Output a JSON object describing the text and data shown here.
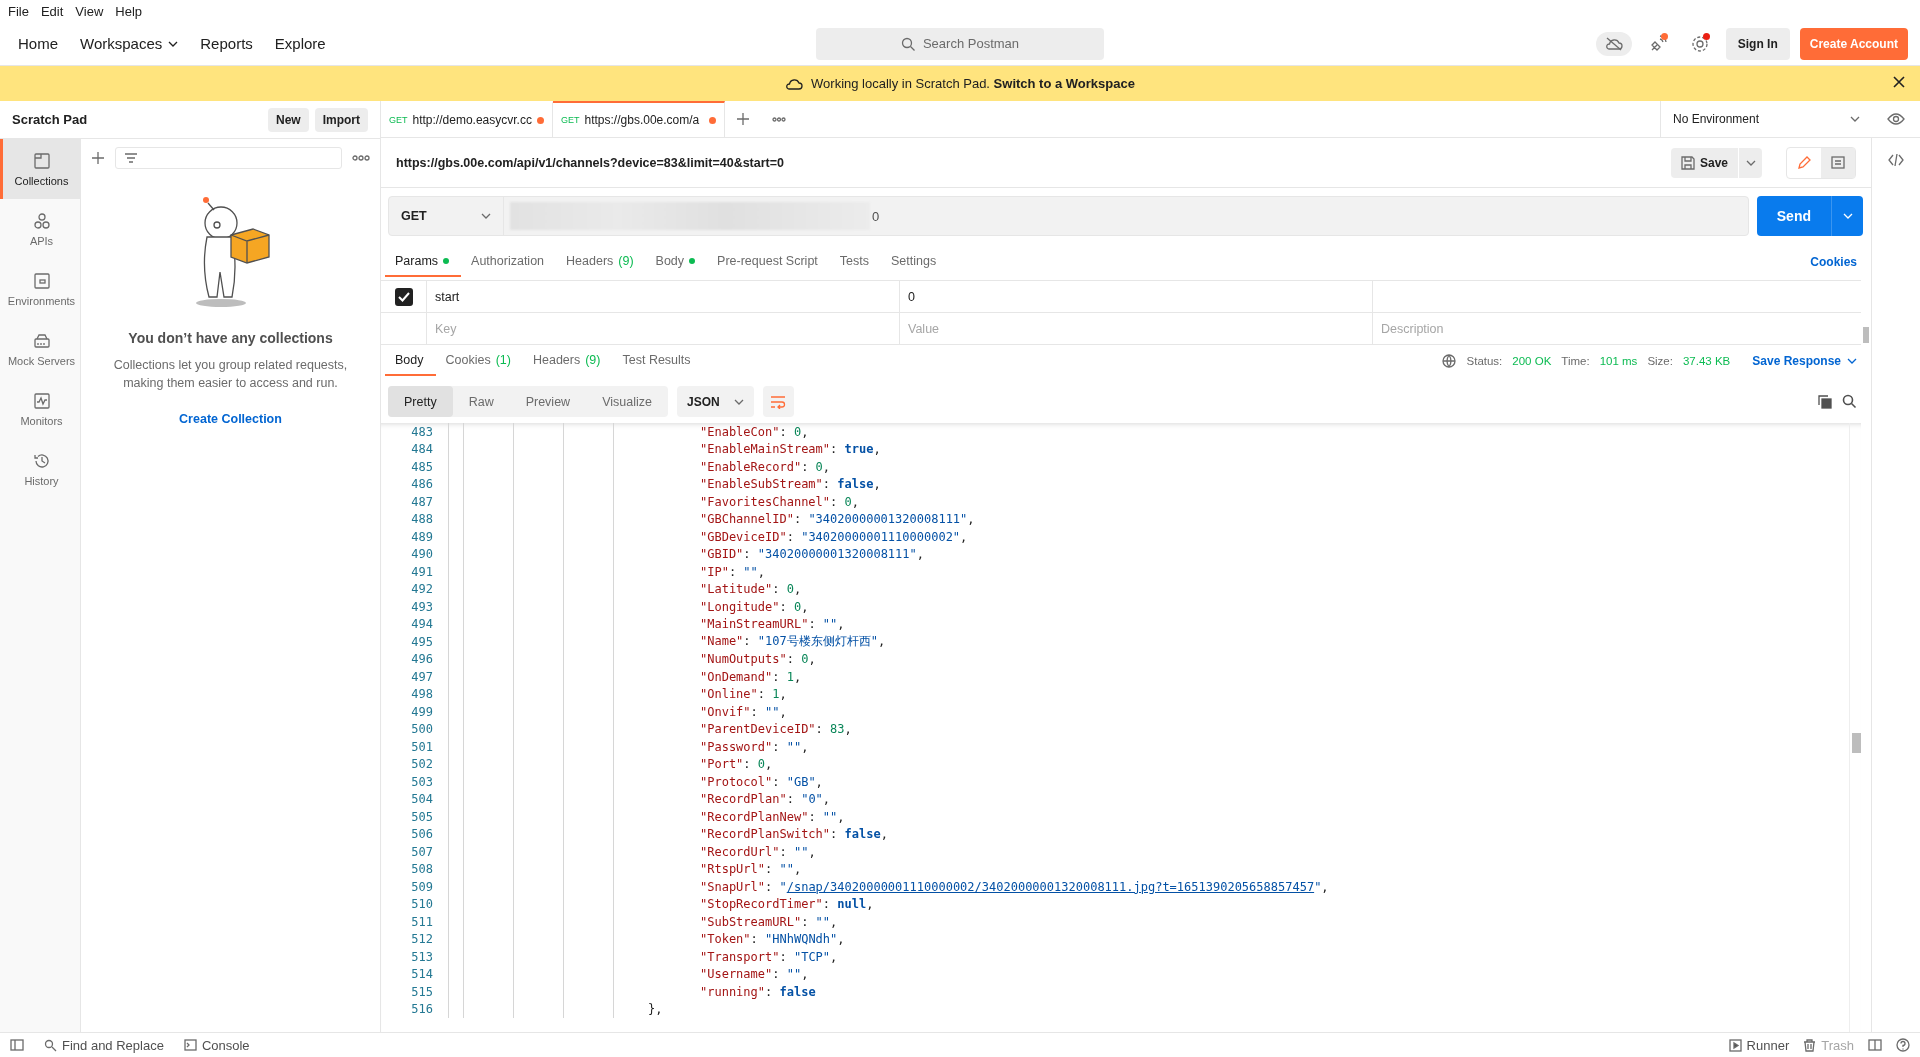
{
  "menu_bar": [
    "File",
    "Edit",
    "View",
    "Help"
  ],
  "header": {
    "nav": [
      {
        "label": "Home",
        "dropdown": false
      },
      {
        "label": "Workspaces",
        "dropdown": true
      },
      {
        "label": "Reports",
        "dropdown": false
      },
      {
        "label": "Explore",
        "dropdown": false
      }
    ],
    "search": {
      "placeholder": "Search Postman"
    },
    "sign_in": "Sign In",
    "create_account": "Create Account"
  },
  "banner": {
    "message": "Working locally in Scratch Pad. **Switch to a Workspace**"
  },
  "sidebar": {
    "title": "Scratch Pad",
    "buttons": [
      "New",
      "Import"
    ],
    "rail": [
      {
        "label": "Collections",
        "selected": true
      },
      {
        "label": "APIs",
        "selected": false
      },
      {
        "label": "Environments",
        "selected": false
      },
      {
        "label": "Mock Servers",
        "selected": false
      },
      {
        "label": "Monitors",
        "selected": false
      },
      {
        "label": "History",
        "selected": false
      }
    ],
    "empty_state": {
      "title": "You don’t have any collections",
      "description": "Collections let you group related requests, making them easier to access and run.",
      "action": "Create Collection"
    }
  },
  "request_tabs": [
    {
      "method": "GET",
      "label": "http://demo.easycvr.cc",
      "unsaved": true,
      "selected": false
    },
    {
      "method": "GET",
      "label": "https://gbs.00e.com/a",
      "unsaved": true,
      "selected": true
    }
  ],
  "environment": "No Environment",
  "request": {
    "title": "https://gbs.00e.com/api/v1/channels?device=83&limit=40&start=0",
    "save": "Save",
    "method": "GET",
    "url_visible": "0",
    "send": "Send",
    "tabs": [
      {
        "label": "Params",
        "dot": true,
        "selected": true
      },
      {
        "label": "Authorization",
        "dot": false,
        "selected": false
      },
      {
        "label": "Headers",
        "count": "(9)",
        "dot": false,
        "selected": false
      },
      {
        "label": "Body",
        "dot": true,
        "selected": false
      },
      {
        "label": "Pre-request Script",
        "dot": false,
        "selected": false
      },
      {
        "label": "Tests",
        "dot": false,
        "selected": false
      },
      {
        "label": "Settings",
        "dot": false,
        "selected": false
      }
    ],
    "cookies_link": "Cookies",
    "params": [
      {
        "checked": true,
        "key": "start",
        "value": "0"
      }
    ],
    "new_param": [
      {
        "placeholder": "Key"
      },
      {
        "placeholder": "Value"
      },
      {
        "placeholder": "Description"
      }
    ]
  },
  "response": {
    "tabs": [
      {
        "label": "Body",
        "selected": true
      },
      {
        "label": "Cookies",
        "count": "(1)",
        "selected": false
      },
      {
        "label": "Headers",
        "count": "(9)",
        "selected": false
      },
      {
        "label": "Test Results",
        "selected": false
      }
    ],
    "status": [
      {
        "label": "Status:",
        "value": "200 OK"
      },
      {
        "label": "Time:",
        "value": "101 ms"
      },
      {
        "label": "Size:",
        "value": "37.43 KB"
      }
    ],
    "save_response": "Save Response",
    "views": [
      {
        "label": "Pretty",
        "selected": true
      },
      {
        "label": "Raw",
        "selected": false
      },
      {
        "label": "Preview",
        "selected": false
      },
      {
        "label": "Visualize",
        "selected": false
      }
    ],
    "format": "JSON",
    "lines": [
      {
        "number": "483",
        "kind": "property",
        "tokens": [
          {
            "kind": "key",
            "text": "\"EnableCon\""
          },
          {
            "kind": "punct",
            "text": ": "
          },
          {
            "kind": "number",
            "text": "0"
          },
          {
            "kind": "punct",
            "text": ","
          }
        ]
      },
      {
        "number": "484",
        "kind": "property",
        "tokens": [
          {
            "kind": "key",
            "text": "\"EnableMainStream\""
          },
          {
            "kind": "punct",
            "text": ": "
          },
          {
            "kind": "keyword",
            "text": "true"
          },
          {
            "kind": "punct",
            "text": ","
          }
        ]
      },
      {
        "number": "485",
        "kind": "property",
        "tokens": [
          {
            "kind": "key",
            "text": "\"EnableRecord\""
          },
          {
            "kind": "punct",
            "text": ": "
          },
          {
            "kind": "number",
            "text": "0"
          },
          {
            "kind": "punct",
            "text": ","
          }
        ]
      },
      {
        "number": "486",
        "kind": "property",
        "tokens": [
          {
            "kind": "key",
            "text": "\"EnableSubStream\""
          },
          {
            "kind": "punct",
            "text": ": "
          },
          {
            "kind": "keyword",
            "text": "false"
          },
          {
            "kind": "punct",
            "text": ","
          }
        ]
      },
      {
        "number": "487",
        "kind": "property",
        "tokens": [
          {
            "kind": "key",
            "text": "\"FavoritesChannel\""
          },
          {
            "kind": "punct",
            "text": ": "
          },
          {
            "kind": "number",
            "text": "0"
          },
          {
            "kind": "punct",
            "text": ","
          }
        ]
      },
      {
        "number": "488",
        "kind": "property",
        "tokens": [
          {
            "kind": "key",
            "text": "\"GBChannelID\""
          },
          {
            "kind": "punct",
            "text": ": "
          },
          {
            "kind": "string",
            "text": "\"34020000001320008111\""
          },
          {
            "kind": "punct",
            "text": ","
          }
        ]
      },
      {
        "number": "489",
        "kind": "property",
        "tokens": [
          {
            "kind": "key",
            "text": "\"GBDeviceID\""
          },
          {
            "kind": "punct",
            "text": ": "
          },
          {
            "kind": "string",
            "text": "\"34020000001110000002\""
          },
          {
            "kind": "punct",
            "text": ","
          }
        ]
      },
      {
        "number": "490",
        "kind": "property",
        "tokens": [
          {
            "kind": "key",
            "text": "\"GBID\""
          },
          {
            "kind": "punct",
            "text": ": "
          },
          {
            "kind": "string",
            "text": "\"34020000001320008111\""
          },
          {
            "kind": "punct",
            "text": ","
          }
        ]
      },
      {
        "number": "491",
        "kind": "property",
        "tokens": [
          {
            "kind": "key",
            "text": "\"IP\""
          },
          {
            "kind": "punct",
            "text": ": "
          },
          {
            "kind": "string",
            "text": "\"\""
          },
          {
            "kind": "punct",
            "text": ","
          }
        ]
      },
      {
        "number": "492",
        "kind": "property",
        "tokens": [
          {
            "kind": "key",
            "text": "\"Latitude\""
          },
          {
            "kind": "punct",
            "text": ": "
          },
          {
            "kind": "number",
            "text": "0"
          },
          {
            "kind": "punct",
            "text": ","
          }
        ]
      },
      {
        "number": "493",
        "kind": "property",
        "tokens": [
          {
            "kind": "key",
            "text": "\"Longitude\""
          },
          {
            "kind": "punct",
            "text": ": "
          },
          {
            "kind": "number",
            "text": "0"
          },
          {
            "kind": "punct",
            "text": ","
          }
        ]
      },
      {
        "number": "494",
        "kind": "property",
        "tokens": [
          {
            "kind": "key",
            "text": "\"MainStreamURL\""
          },
          {
            "kind": "punct",
            "text": ": "
          },
          {
            "kind": "string",
            "text": "\"\""
          },
          {
            "kind": "punct",
            "text": ","
          }
        ]
      },
      {
        "number": "495",
        "kind": "property",
        "tokens": [
          {
            "kind": "key",
            "text": "\"Name\""
          },
          {
            "kind": "punct",
            "text": ": "
          },
          {
            "kind": "string",
            "text": "\"107号楼东侧灯杆西\""
          },
          {
            "kind": "punct",
            "text": ","
          }
        ]
      },
      {
        "number": "496",
        "kind": "property",
        "tokens": [
          {
            "kind": "key",
            "text": "\"NumOutputs\""
          },
          {
            "kind": "punct",
            "text": ": "
          },
          {
            "kind": "number",
            "text": "0"
          },
          {
            "kind": "punct",
            "text": ","
          }
        ]
      },
      {
        "number": "497",
        "kind": "property",
        "tokens": [
          {
            "kind": "key",
            "text": "\"OnDemand\""
          },
          {
            "kind": "punct",
            "text": ": "
          },
          {
            "kind": "number",
            "text": "1"
          },
          {
            "kind": "punct",
            "text": ","
          }
        ]
      },
      {
        "number": "498",
        "kind": "property",
        "tokens": [
          {
            "kind": "key",
            "text": "\"Online\""
          },
          {
            "kind": "punct",
            "text": ": "
          },
          {
            "kind": "number",
            "text": "1"
          },
          {
            "kind": "punct",
            "text": ","
          }
        ]
      },
      {
        "number": "499",
        "kind": "property",
        "tokens": [
          {
            "kind": "key",
            "text": "\"Onvif\""
          },
          {
            "kind": "punct",
            "text": ": "
          },
          {
            "kind": "string",
            "text": "\"\""
          },
          {
            "kind": "punct",
            "text": ","
          }
        ]
      },
      {
        "number": "500",
        "kind": "property",
        "tokens": [
          {
            "kind": "key",
            "text": "\"ParentDeviceID\""
          },
          {
            "kind": "punct",
            "text": ": "
          },
          {
            "kind": "number",
            "text": "83"
          },
          {
            "kind": "punct",
            "text": ","
          }
        ]
      },
      {
        "number": "501",
        "kind": "property",
        "tokens": [
          {
            "kind": "key",
            "text": "\"Password\""
          },
          {
            "kind": "punct",
            "text": ": "
          },
          {
            "kind": "string",
            "text": "\"\""
          },
          {
            "kind": "punct",
            "text": ","
          }
        ]
      },
      {
        "number": "502",
        "kind": "property",
        "tokens": [
          {
            "kind": "key",
            "text": "\"Port\""
          },
          {
            "kind": "punct",
            "text": ": "
          },
          {
            "kind": "number",
            "text": "0"
          },
          {
            "kind": "punct",
            "text": ","
          }
        ]
      },
      {
        "number": "503",
        "kind": "property",
        "tokens": [
          {
            "kind": "key",
            "text": "\"Protocol\""
          },
          {
            "kind": "punct",
            "text": ": "
          },
          {
            "kind": "string",
            "text": "\"GB\""
          },
          {
            "kind": "punct",
            "text": ","
          }
        ]
      },
      {
        "number": "504",
        "kind": "property",
        "tokens": [
          {
            "kind": "key",
            "text": "\"RecordPlan\""
          },
          {
            "kind": "punct",
            "text": ": "
          },
          {
            "kind": "string",
            "text": "\"0\""
          },
          {
            "kind": "punct",
            "text": ","
          }
        ]
      },
      {
        "number": "505",
        "kind": "property",
        "tokens": [
          {
            "kind": "key",
            "text": "\"RecordPlanNew\""
          },
          {
            "kind": "punct",
            "text": ": "
          },
          {
            "kind": "string",
            "text": "\"\""
          },
          {
            "kind": "punct",
            "text": ","
          }
        ]
      },
      {
        "number": "506",
        "kind": "property",
        "tokens": [
          {
            "kind": "key",
            "text": "\"RecordPlanSwitch\""
          },
          {
            "kind": "punct",
            "text": ": "
          },
          {
            "kind": "keyword",
            "text": "false"
          },
          {
            "kind": "punct",
            "text": ","
          }
        ]
      },
      {
        "number": "507",
        "kind": "property",
        "tokens": [
          {
            "kind": "key",
            "text": "\"RecordUrl\""
          },
          {
            "kind": "punct",
            "text": ": "
          },
          {
            "kind": "string",
            "text": "\"\""
          },
          {
            "kind": "punct",
            "text": ","
          }
        ]
      },
      {
        "number": "508",
        "kind": "property",
        "tokens": [
          {
            "kind": "key",
            "text": "\"RtspUrl\""
          },
          {
            "kind": "punct",
            "text": ": "
          },
          {
            "kind": "string",
            "text": "\"\""
          },
          {
            "kind": "punct",
            "text": ","
          }
        ]
      },
      {
        "number": "509",
        "kind": "property",
        "tokens": [
          {
            "kind": "key",
            "text": "\"SnapUrl\""
          },
          {
            "kind": "punct",
            "text": ": "
          },
          {
            "kind": "string",
            "text": "\""
          },
          {
            "kind": "link",
            "text": "/snap/34020000001110000002/34020000001320008111.jpg?t=1651390205658857457"
          },
          {
            "kind": "string",
            "text": "\""
          },
          {
            "kind": "punct",
            "text": ","
          }
        ]
      },
      {
        "number": "510",
        "kind": "property",
        "tokens": [
          {
            "kind": "key",
            "text": "\"StopRecordTimer\""
          },
          {
            "kind": "punct",
            "text": ": "
          },
          {
            "kind": "keyword",
            "text": "null"
          },
          {
            "kind": "punct",
            "text": ","
          }
        ]
      },
      {
        "number": "511",
        "kind": "property",
        "tokens": [
          {
            "kind": "key",
            "text": "\"SubStreamURL\""
          },
          {
            "kind": "punct",
            "text": ": "
          },
          {
            "kind": "string",
            "text": "\"\""
          },
          {
            "kind": "punct",
            "text": ","
          }
        ]
      },
      {
        "number": "512",
        "kind": "property",
        "tokens": [
          {
            "kind": "key",
            "text": "\"Token\""
          },
          {
            "kind": "punct",
            "text": ": "
          },
          {
            "kind": "string",
            "text": "\"HNhWQNdh\""
          },
          {
            "kind": "punct",
            "text": ","
          }
        ]
      },
      {
        "number": "513",
        "kind": "property",
        "tokens": [
          {
            "kind": "key",
            "text": "\"Transport\""
          },
          {
            "kind": "punct",
            "text": ": "
          },
          {
            "kind": "string",
            "text": "\"TCP\""
          },
          {
            "kind": "punct",
            "text": ","
          }
        ]
      },
      {
        "number": "514",
        "kind": "property",
        "tokens": [
          {
            "kind": "key",
            "text": "\"Username\""
          },
          {
            "kind": "punct",
            "text": ": "
          },
          {
            "kind": "string",
            "text": "\"\""
          },
          {
            "kind": "punct",
            "text": ","
          }
        ]
      },
      {
        "number": "515",
        "kind": "property",
        "tokens": [
          {
            "kind": "key",
            "text": "\"running\""
          },
          {
            "kind": "punct",
            "text": ": "
          },
          {
            "kind": "keyword",
            "text": "false"
          }
        ]
      },
      {
        "number": "516",
        "kind": "closing",
        "tokens": [
          {
            "kind": "punct",
            "text": "},"
          }
        ]
      }
    ]
  },
  "status_bar": {
    "left": [
      {
        "label": "Find and Replace"
      },
      {
        "label": "Console"
      }
    ],
    "right": [
      {
        "label": "Runner",
        "disabled": false
      },
      {
        "label": "Trash",
        "disabled": true
      }
    ]
  }
}
